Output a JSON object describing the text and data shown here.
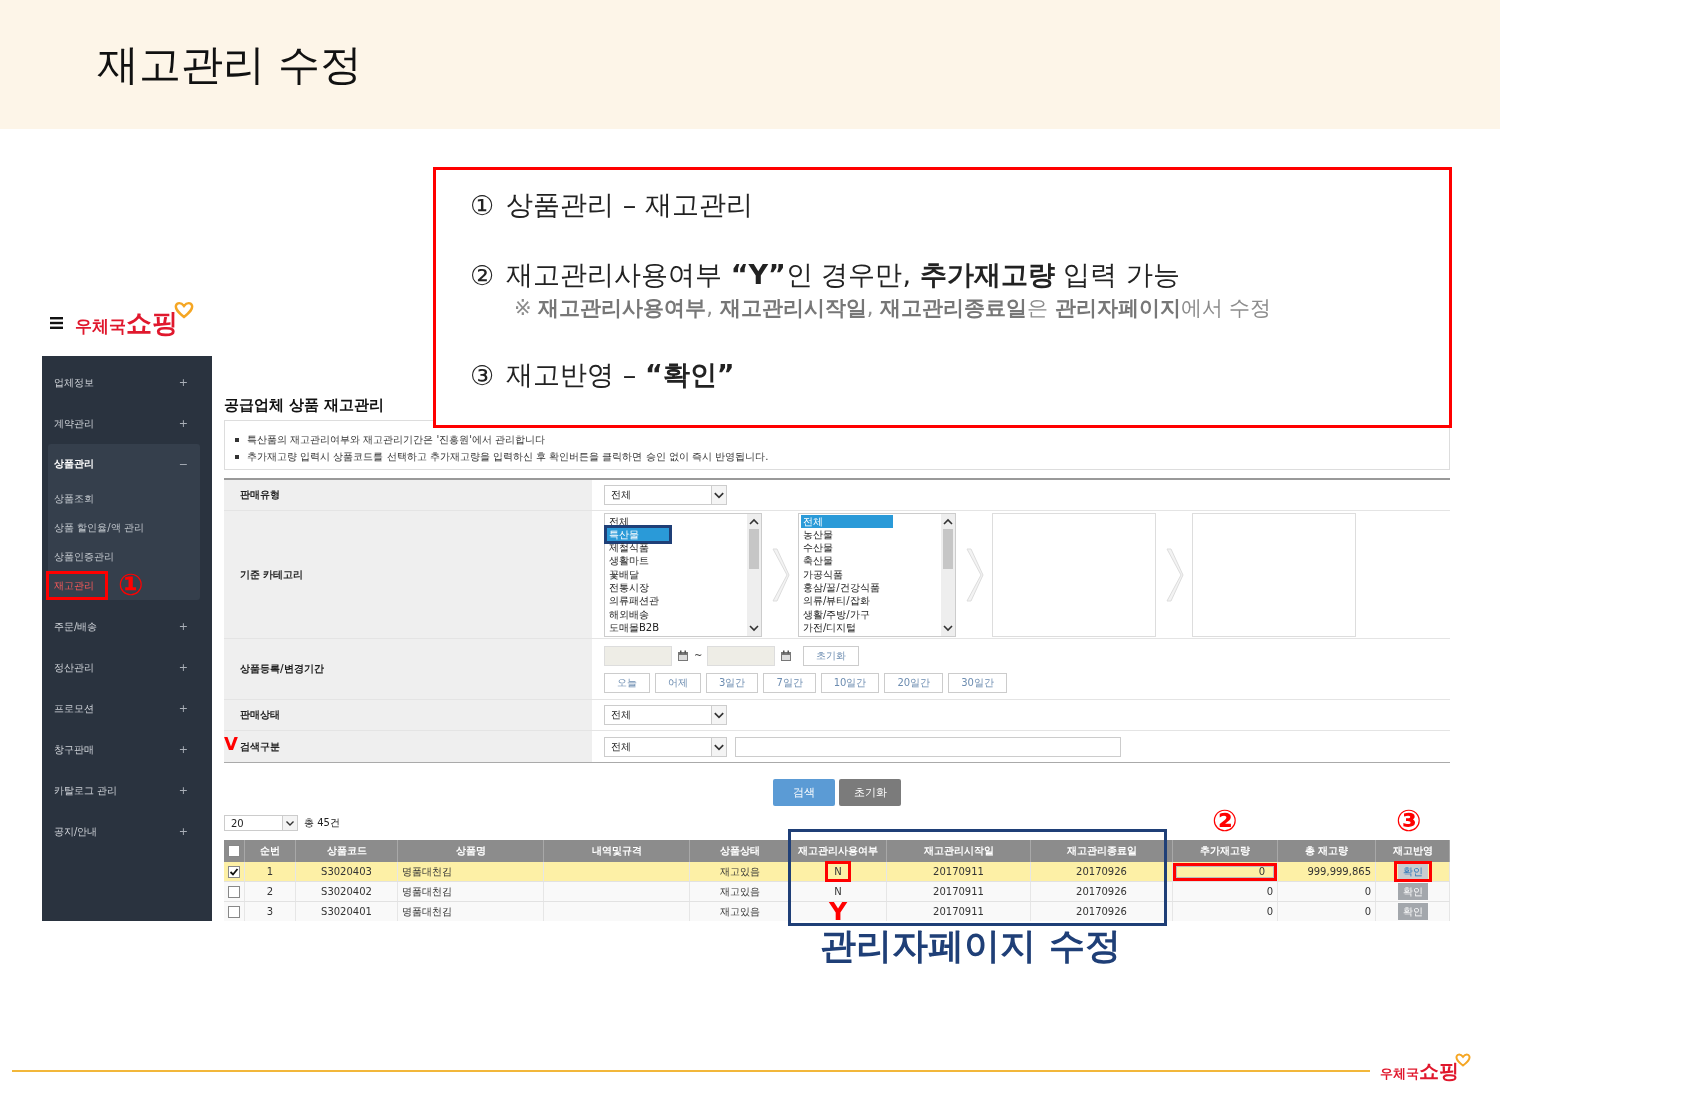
{
  "slide": {
    "title": "재고관리 수정"
  },
  "callout": {
    "items": [
      {
        "marker": "①",
        "text": "상품관리 – 재고관리"
      },
      {
        "marker": "②",
        "text": "재고관리사용여부 **“Y”**인 경우만, **추가재고량** 입력 가능",
        "note": "※ **재고관리사용여부**, **재고관리시작일**, **재고관리종료일**은 **관리자페이지**에서 수정"
      },
      {
        "marker": "③",
        "text": "재고반영 – **“확인”**"
      }
    ]
  },
  "logo": {
    "text": "우체국**쇼핑**"
  },
  "sidebar": {
    "items": [
      {
        "label": "업체정보",
        "toggle": "+",
        "expanded": false
      },
      {
        "label": "계약관리",
        "toggle": "+",
        "expanded": false
      },
      {
        "label": "상품관리",
        "toggle": "−",
        "expanded": true,
        "children": [
          {
            "label": "상품조회",
            "selected": false
          },
          {
            "label": "상품 할인율/액 관리",
            "selected": false
          },
          {
            "label": "상품인증관리",
            "selected": false
          },
          {
            "label": "재고관리",
            "selected": true
          }
        ]
      },
      {
        "label": "주문/배송",
        "toggle": "+",
        "expanded": false
      },
      {
        "label": "정산관리",
        "toggle": "+",
        "expanded": false
      },
      {
        "label": "프로모션",
        "toggle": "+",
        "expanded": false
      },
      {
        "label": "창구판매",
        "toggle": "+",
        "expanded": false
      },
      {
        "label": "카탈로그 관리",
        "toggle": "+",
        "expanded": false
      },
      {
        "label": "공지/안내",
        "toggle": "+",
        "expanded": false
      }
    ]
  },
  "page": {
    "title": "공급업체 상품 재고관리",
    "notices": [
      "특산품의 재고관리여부와 재고관리기간은 '진흥원'에서 관리합니다",
      "추가재고량 입력시 상품코드를 선택하고 추가재고량을 입력하신 후 확인버튼을 클릭하면 승인 없이 즉시 반영됩니다."
    ]
  },
  "filters": [
    {
      "label": "판매유형",
      "kind": "select",
      "value": "전체"
    },
    {
      "label": "기준 카테고리",
      "kind": "category",
      "lists": [
        [
          {
            "label": "전체",
            "selected": false,
            "framed": false
          },
          {
            "label": "특산물",
            "selected": true,
            "framed": true
          },
          {
            "label": "제철식품",
            "selected": false,
            "framed": false
          },
          {
            "label": "생활마트",
            "selected": false,
            "framed": false
          },
          {
            "label": "꽃배달",
            "selected": false,
            "framed": false
          },
          {
            "label": "전통시장",
            "selected": false,
            "framed": false
          },
          {
            "label": "의류패션관",
            "selected": false,
            "framed": false
          },
          {
            "label": "해외배송",
            "selected": false,
            "framed": false
          },
          {
            "label": "도매몰B2B",
            "selected": false,
            "framed": false
          }
        ],
        [
          {
            "label": "전체",
            "selected": true,
            "framed": false
          },
          {
            "label": "농산물",
            "selected": false,
            "framed": false
          },
          {
            "label": "수산물",
            "selected": false,
            "framed": false
          },
          {
            "label": "축산물",
            "selected": false,
            "framed": false
          },
          {
            "label": "가공식품",
            "selected": false,
            "framed": false
          },
          {
            "label": "홍삼/꿀/건강식품",
            "selected": false,
            "framed": false
          },
          {
            "label": "의류/뷰티/잡화",
            "selected": false,
            "framed": false
          },
          {
            "label": "생활/주방/가구",
            "selected": false,
            "framed": false
          },
          {
            "label": "가전/디지털",
            "selected": false,
            "framed": false
          }
        ]
      ]
    },
    {
      "label": "상품등록/변경기간",
      "kind": "period",
      "separator": "~",
      "reset": "초기화",
      "ranges": [
        "오늘",
        "어제",
        "3일간",
        "7일간",
        "10일간",
        "20일간",
        "30일간"
      ]
    },
    {
      "label": "판매상태",
      "kind": "select",
      "value": "전체"
    },
    {
      "label": "검색구분",
      "kind": "search",
      "value": "전체"
    }
  ],
  "actions": [
    {
      "label": "검색",
      "kind": "primary"
    },
    {
      "label": "초기화",
      "kind": "secondary"
    }
  ],
  "list": {
    "page_size": "20",
    "total": "총 45건",
    "all_checked": false,
    "columns": [
      "순번",
      "상품코드",
      "상품명",
      "내역및규격",
      "상품상태",
      "재고관리사용여부",
      "재고관리시작일",
      "재고관리종료일",
      "추가재고량",
      "총 재고량",
      "재고반영"
    ],
    "rows": [
      {
        "checked": true,
        "selected": true,
        "marked": true,
        "no": "1",
        "code": "S3020403",
        "name": "명품대천김",
        "status": "재고있음",
        "stock_managed": "N",
        "start": "20170911",
        "end": "20170926",
        "add_qty": "0",
        "add_qty_editable": true,
        "total": "999,999,865",
        "apply": "확인",
        "apply_disabled": false
      },
      {
        "checked": false,
        "selected": false,
        "marked": false,
        "no": "2",
        "code": "S3020402",
        "name": "명품대천김",
        "status": "재고있음",
        "stock_managed": "N",
        "start": "20170911",
        "end": "20170926",
        "add_qty": "0",
        "add_qty_editable": false,
        "total": "0",
        "apply": "확인",
        "apply_disabled": true
      },
      {
        "checked": false,
        "selected": false,
        "marked": false,
        "no": "3",
        "code": "S3020401",
        "name": "명품대천김",
        "status": "재고있음",
        "usage_mark": "Y",
        "start": "20170911",
        "end": "20170926",
        "add_qty": "0",
        "add_qty_editable": false,
        "total": "0",
        "apply": "확인",
        "apply_disabled": true
      }
    ]
  },
  "annotations": {
    "sidebar_marker": "①",
    "qty_marker": "②",
    "apply_marker": "③",
    "search_mark": "V",
    "admin_note": "관리자페이지 수정"
  },
  "footer": {
    "logo": "우체국**쇼핑**"
  }
}
